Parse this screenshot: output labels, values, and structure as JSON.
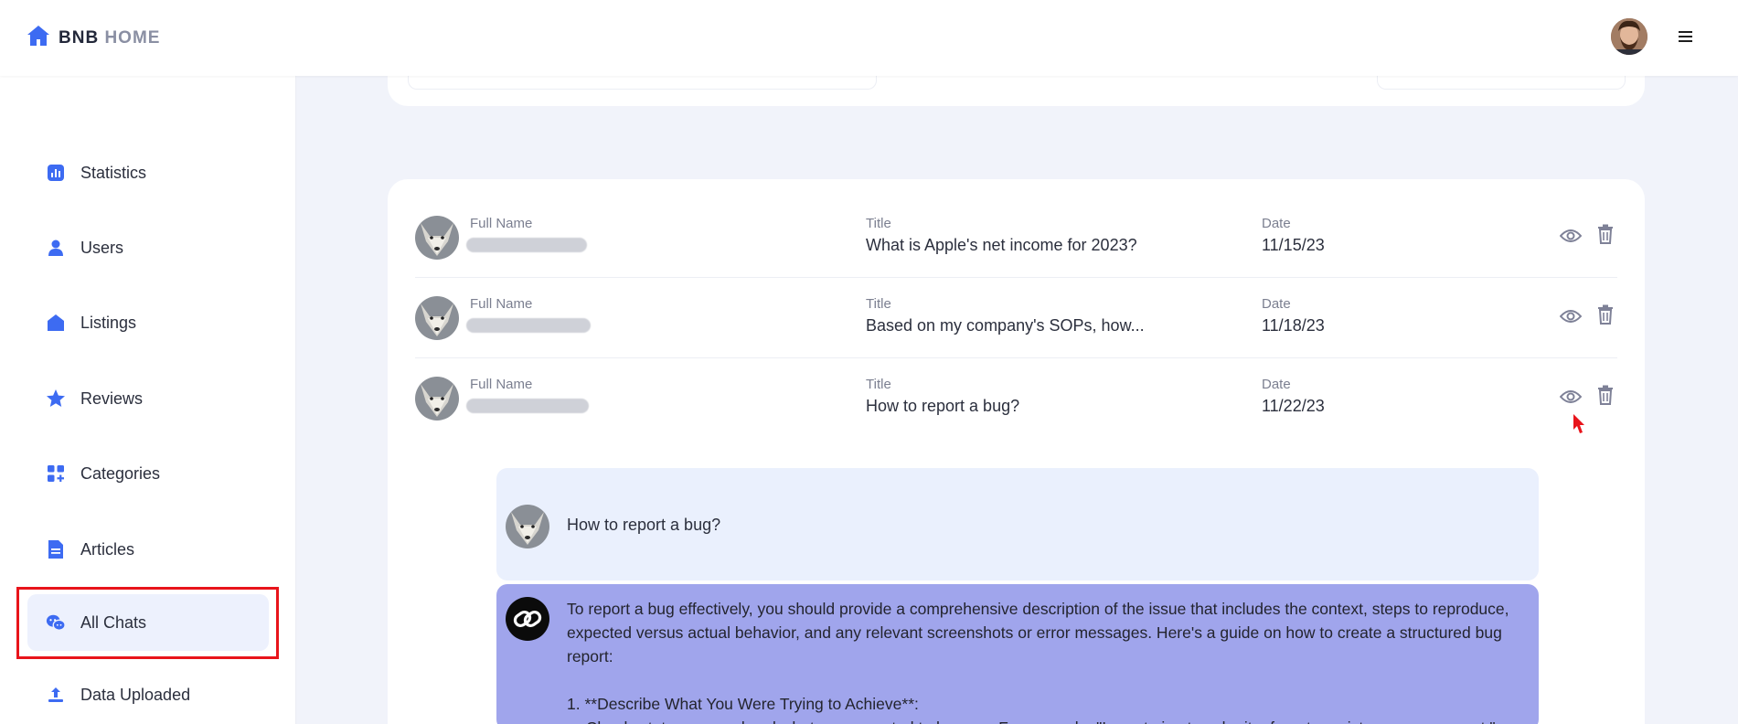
{
  "brand": {
    "name_bold": "BNB",
    "name_muted": "HOME",
    "logo_icon": "house-icon",
    "accent": "#3d6bf2"
  },
  "header": {
    "avatar_icon": "user-avatar",
    "menu_icon": "hamburger-icon"
  },
  "sidebar": {
    "items": [
      {
        "label": "Statistics",
        "icon": "chart-icon"
      },
      {
        "label": "Users",
        "icon": "user-icon"
      },
      {
        "label": "Listings",
        "icon": "home-icon"
      },
      {
        "label": "Reviews",
        "icon": "star-icon"
      },
      {
        "label": "Categories",
        "icon": "categories-icon"
      },
      {
        "label": "Articles",
        "icon": "document-icon"
      },
      {
        "label": "All Chats",
        "icon": "chat-icon",
        "active": true
      },
      {
        "label": "Data Uploaded",
        "icon": "upload-icon"
      }
    ]
  },
  "chats": {
    "columns": {
      "name": "Full Name",
      "title": "Title",
      "date": "Date"
    },
    "rows": [
      {
        "title": "What is Apple's net income for 2023?",
        "date": "11/15/23"
      },
      {
        "title": "Based on my company's SOPs, how...",
        "date": "11/18/23"
      },
      {
        "title": "How to report a bug?",
        "date": "11/22/23"
      }
    ]
  },
  "conversation": {
    "user_message": "How to report a bug?",
    "bot_message": {
      "paragraph1": "To report a bug effectively, you should provide a comprehensive description of the issue that includes the context, steps to reproduce, expected versus actual behavior, and any relevant screenshots or error messages. Here's a guide on how to create a structured bug report:",
      "step1": "1. **Describe What You Were Trying to Achieve**:",
      "step1_detail": "- Clearly state your goal and what you expected to happen. For example, \"I was trying to submit a form to register a new account.\""
    }
  },
  "colors": {
    "active_bg": "#edf1fd",
    "bot_bubble": "#a0a5ec",
    "user_bubble": "#eaf0fd",
    "highlight": "#e8141b"
  }
}
